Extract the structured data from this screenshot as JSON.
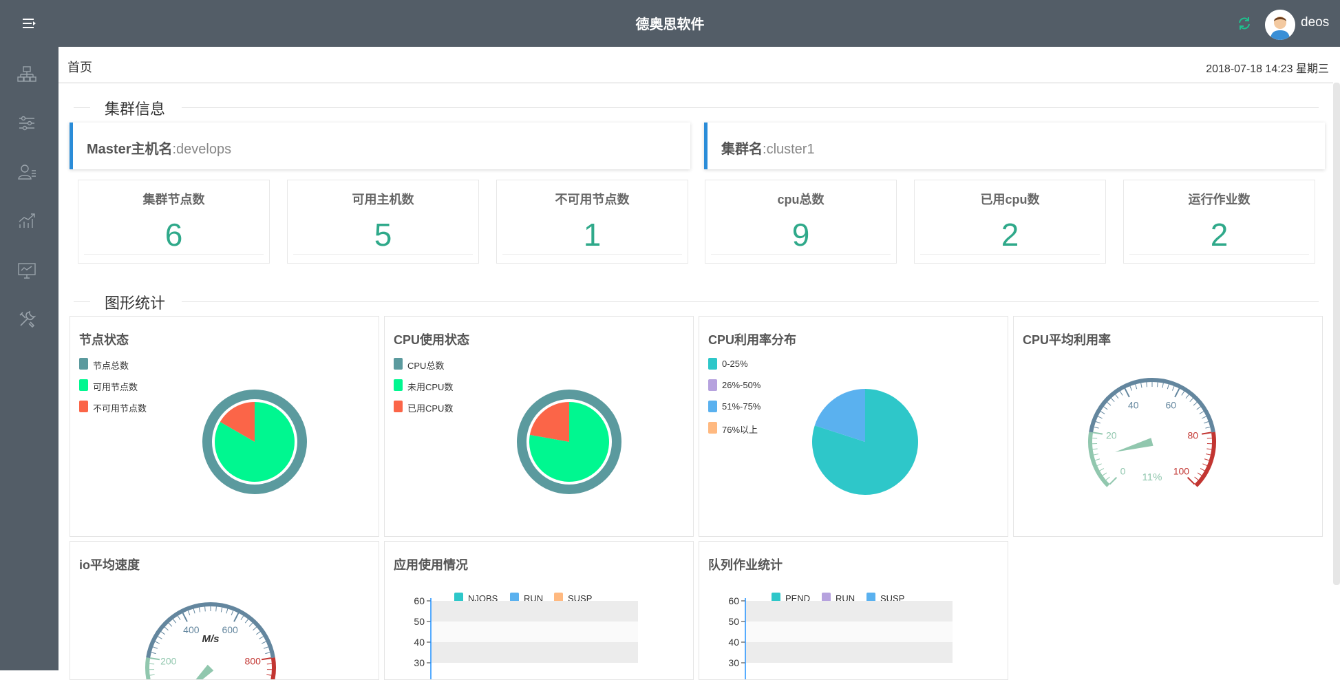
{
  "app": {
    "title": "德奥思软件",
    "username": "deos"
  },
  "breadcrumb": {
    "label": "首页",
    "datetime": "2018-07-18 14:23 星期三"
  },
  "sections": {
    "cluster_info": "集群信息",
    "charts": "图形统计"
  },
  "info_cards": [
    {
      "key": "Master主机名",
      "sep": ":",
      "value": "develops"
    },
    {
      "key": "集群名",
      "sep": ":",
      "value": "cluster1"
    }
  ],
  "stats": [
    {
      "label": "集群节点数",
      "value": "6"
    },
    {
      "label": "可用主机数",
      "value": "5"
    },
    {
      "label": "不可用节点数",
      "value": "1"
    },
    {
      "label": "cpu总数",
      "value": "9"
    },
    {
      "label": "已用cpu数",
      "value": "2"
    },
    {
      "label": "运行作业数",
      "value": "2"
    }
  ],
  "colors": {
    "accent": "#2fa98a",
    "topbar": "#535d67",
    "card_border": "#2a8cd8"
  },
  "panels": {
    "node_status": {
      "title": "节点状态",
      "legend": [
        {
          "label": "节点总数",
          "color": "#5b9a9e"
        },
        {
          "label": "可用节点数",
          "color": "#00f790"
        },
        {
          "label": "不可用节点数",
          "color": "#fb6548"
        }
      ]
    },
    "cpu_status": {
      "title": "CPU使用状态",
      "legend": [
        {
          "label": "CPU总数",
          "color": "#5b9a9e"
        },
        {
          "label": "未用CPU数",
          "color": "#00f790"
        },
        {
          "label": "已用CPU数",
          "color": "#fb6548"
        }
      ]
    },
    "cpu_dist": {
      "title": "CPU利用率分布",
      "legend": [
        {
          "label": "0-25%",
          "color": "#2ec7c9"
        },
        {
          "label": "26%-50%",
          "color": "#b6a2de"
        },
        {
          "label": "51%-75%",
          "color": "#5ab1ef"
        },
        {
          "label": "76%以上",
          "color": "#ffb980"
        }
      ]
    },
    "cpu_avg": {
      "title": "CPU平均利用率",
      "value_label": "11%"
    },
    "io_speed": {
      "title": "io平均速度",
      "unit": "M/s"
    },
    "app_usage": {
      "title": "应用使用情况",
      "legend": [
        {
          "label": "NJOBS",
          "color": "#2ec7c9"
        },
        {
          "label": "RUN",
          "color": "#5ab1ef"
        },
        {
          "label": "SUSP",
          "color": "#ffb980"
        }
      ]
    },
    "queue_stats": {
      "title": "队列作业统计",
      "legend": [
        {
          "label": "PEND",
          "color": "#2ec7c9"
        },
        {
          "label": "RUN",
          "color": "#b6a2de"
        },
        {
          "label": "SUSP",
          "color": "#5ab1ef"
        }
      ]
    }
  },
  "chart_data": [
    {
      "type": "pie",
      "title": "节点状态",
      "labels": [
        "节点总数",
        "可用节点数",
        "不可用节点数"
      ],
      "values": [
        6,
        5,
        1
      ]
    },
    {
      "type": "pie",
      "title": "CPU使用状态",
      "labels": [
        "CPU总数",
        "未用CPU数",
        "已用CPU数"
      ],
      "values": [
        9,
        7,
        2
      ]
    },
    {
      "type": "pie",
      "title": "CPU利用率分布",
      "labels": [
        "0-25%",
        "26%-50%",
        "51%-75%",
        "76%以上"
      ],
      "values": [
        4,
        0,
        1,
        0
      ]
    },
    {
      "type": "gauge",
      "title": "CPU平均利用率",
      "min": 0,
      "max": 100,
      "ticks": [
        "0",
        "20",
        "40",
        "60",
        "80",
        "100"
      ],
      "value": 11,
      "value_label": "11%"
    },
    {
      "type": "gauge",
      "title": "io平均速度",
      "min": 0,
      "max": 1000,
      "ticks": [
        "200",
        "400",
        "600",
        "800"
      ],
      "unit": "M/s",
      "value": 0
    },
    {
      "type": "bar",
      "title": "应用使用情况",
      "series": [
        {
          "name": "NJOBS"
        },
        {
          "name": "RUN"
        },
        {
          "name": "SUSP"
        }
      ],
      "yticks": [
        "60",
        "50",
        "40",
        "30"
      ]
    },
    {
      "type": "bar",
      "title": "队列作业统计",
      "series": [
        {
          "name": "PEND"
        },
        {
          "name": "RUN"
        },
        {
          "name": "SUSP"
        }
      ],
      "yticks": [
        "60",
        "50",
        "40",
        "30"
      ]
    }
  ]
}
